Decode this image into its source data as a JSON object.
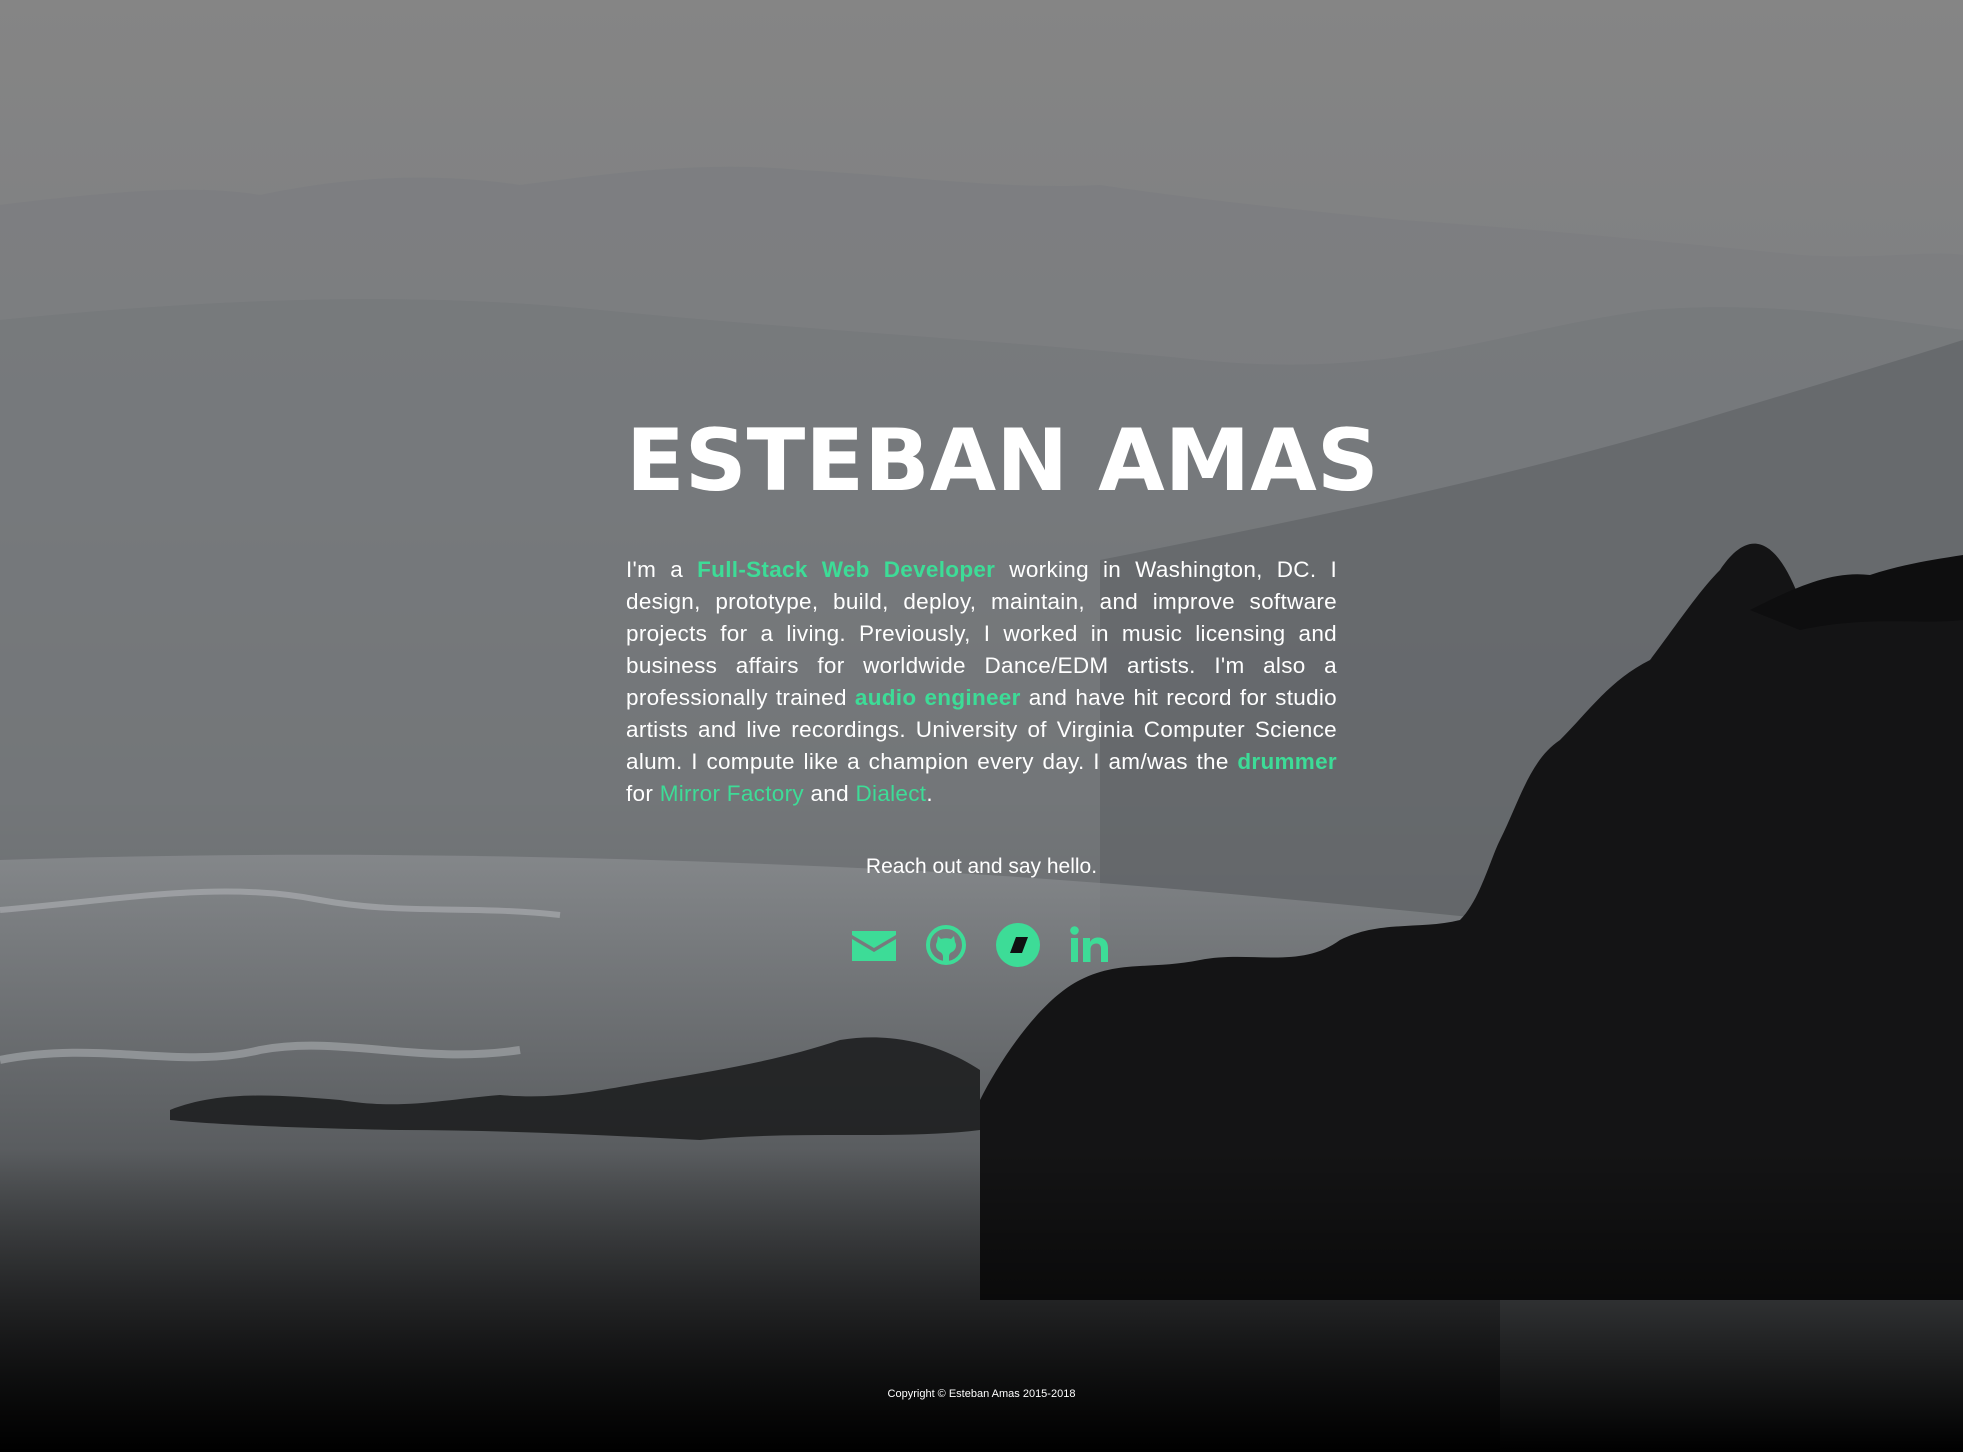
{
  "hero": {
    "name": "ESTEBAN AMAS"
  },
  "bio": {
    "p1": "I'm a ",
    "role": "Full-Stack Web Developer",
    "p2": " working in Washington, DC. I design, prototype, build, deploy, maintain, and improve software projects for a living. Previously, I worked in music licensing and business affairs for worldwide Dance/EDM artists. I'm also a professionally trained ",
    "audio": "audio engineer",
    "p3": " and have hit record for studio artists and live recordings. University of Virginia Computer Science alum. I compute like a champion every day. I am/was the ",
    "drummer": "drummer",
    "p4": " for ",
    "band1": "Mirror Factory",
    "p5": " and ",
    "band2": "Dialect",
    "p6": "."
  },
  "contact": {
    "hello": "Reach out and say hello."
  },
  "social": [
    {
      "icon": "envelope-icon"
    },
    {
      "icon": "github-icon"
    },
    {
      "icon": "codepen-icon"
    },
    {
      "icon": "linkedin-icon"
    }
  ],
  "footer": {
    "copyright": "Copyright © Esteban Amas 2015-2018"
  },
  "colors": {
    "accent": "#3ddc97",
    "text": "#ffffff",
    "sky": "#7f7f7f",
    "ground": "#000000"
  }
}
